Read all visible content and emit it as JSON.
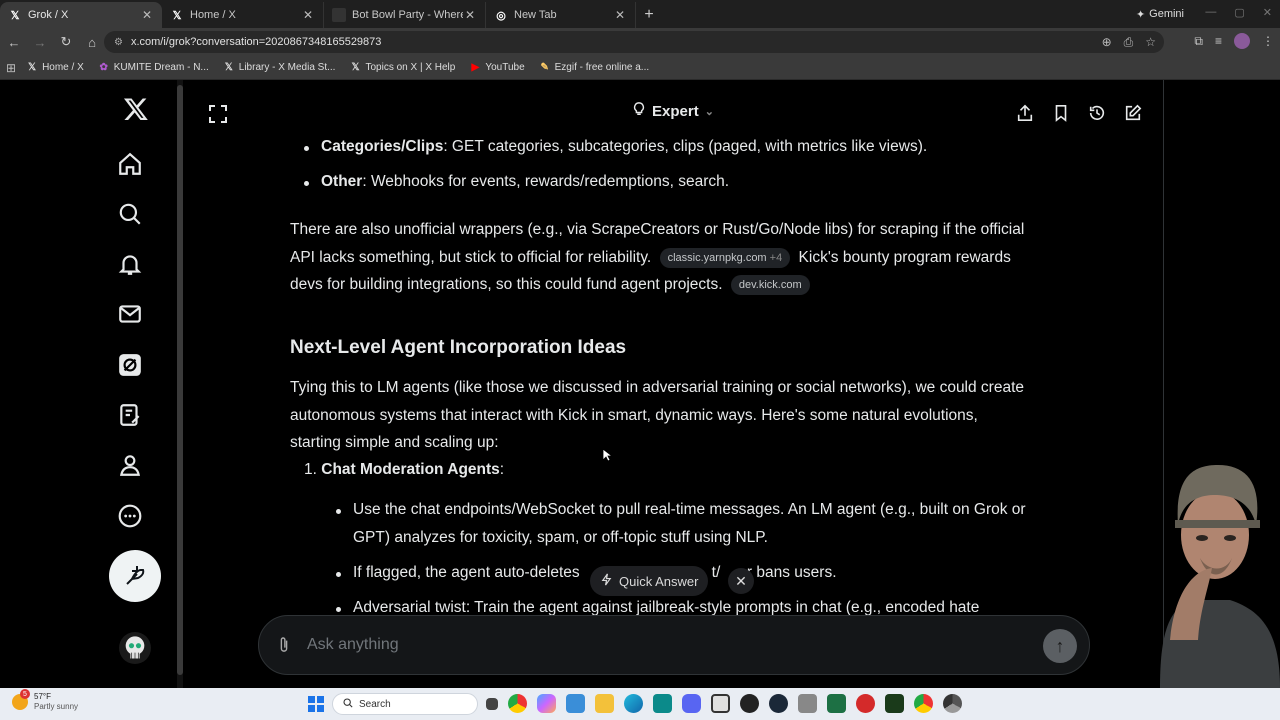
{
  "browser": {
    "tabs": [
      {
        "label": "Grok / X",
        "icon": "x-logo-icon",
        "active": true
      },
      {
        "label": "Home / X",
        "icon": "x-logo-icon",
        "active": false
      },
      {
        "label": "Bot Bowl Party - Where AI Agen",
        "icon": "bot-bowl-icon",
        "active": false
      },
      {
        "label": "New Tab",
        "icon": "chrome-icon",
        "active": false
      }
    ],
    "gemini_label": "Gemini",
    "url": "x.com/i/grok?conversation=2020867348165529873",
    "bookmarks": [
      {
        "label": "Home / X",
        "icon": "x-logo-icon"
      },
      {
        "label": "KUMITE Dream - N...",
        "icon": "kumite-icon"
      },
      {
        "label": "Library - X Media St...",
        "icon": "x-logo-icon"
      },
      {
        "label": "Topics on X | X Help",
        "icon": "x-logo-icon"
      },
      {
        "label": "YouTube",
        "icon": "youtube-icon"
      },
      {
        "label": "Ezgif - free online a...",
        "icon": "ezgif-icon"
      }
    ]
  },
  "grok": {
    "mode_label": "Expert",
    "list_top": [
      {
        "label": "Categories/Clips",
        "text": ": GET categories, subcategories, clips (paged, with metrics like views)."
      },
      {
        "label": "Other",
        "text": ": Webhooks for events, rewards/redemptions, search."
      }
    ],
    "para1": {
      "line1": "There are also unofficial wrappers (e.g., via ScrapeCreators or Rust/Go/Node libs) for scraping if the official",
      "line2a": "API lacks something, but stick to official for reliability.",
      "cite1": "classic.yarnpkg.com",
      "cite1_more": "+4",
      "line2b": "Kick's bounty program rewards",
      "line3": "devs for building integrations, so this could fund agent projects.",
      "cite2": "dev.kick.com"
    },
    "heading": "Next-Level Agent Incorporation Ideas",
    "para2": {
      "line1": "Tying this to LM agents (like those we discussed in adversarial training or social networks), we could create",
      "line2": "autonomous systems that interact with Kick in smart, dynamic ways. Here's some natural evolutions,",
      "line3": "starting simple and scaling up:"
    },
    "numbered": {
      "num": "1.",
      "label": "Chat Moderation Agents",
      "suffix": ":"
    },
    "sub_items": [
      {
        "line1": "Use the chat endpoints/WebSocket to pull real-time messages. An LM agent (e.g., built on Grok or",
        "line2": "GPT) analyzes for toxicity, spam, or off-topic stuff using NLP."
      },
      {
        "line1a": "If flagged, the agent auto-deletes",
        "line1b": "t/",
        "line1c": "or bans users."
      },
      {
        "line1": "Adversarial twist: Train the agent against jailbreak-style prompts in chat (e.g., encoded hate"
      }
    ],
    "quick_answer": "Quick Answer",
    "ask_placeholder": "Ask anything"
  },
  "taskbar": {
    "temp": "57°F",
    "condition": "Partly sunny",
    "weather_badge": "5",
    "search_label": "Search",
    "apps": [
      "file-explorer-icon",
      "chrome-icon",
      "copilot-icon",
      "photos-icon",
      "folder-icon",
      "edge-icon",
      "calculator-icon",
      "discord-icon",
      "snipping-icon",
      "media-icon",
      "steam-icon",
      "game-icon",
      "excel-icon",
      "red-app-icon",
      "terminal-icon",
      "chrome-alt-icon",
      "chrome-dev-icon"
    ]
  }
}
